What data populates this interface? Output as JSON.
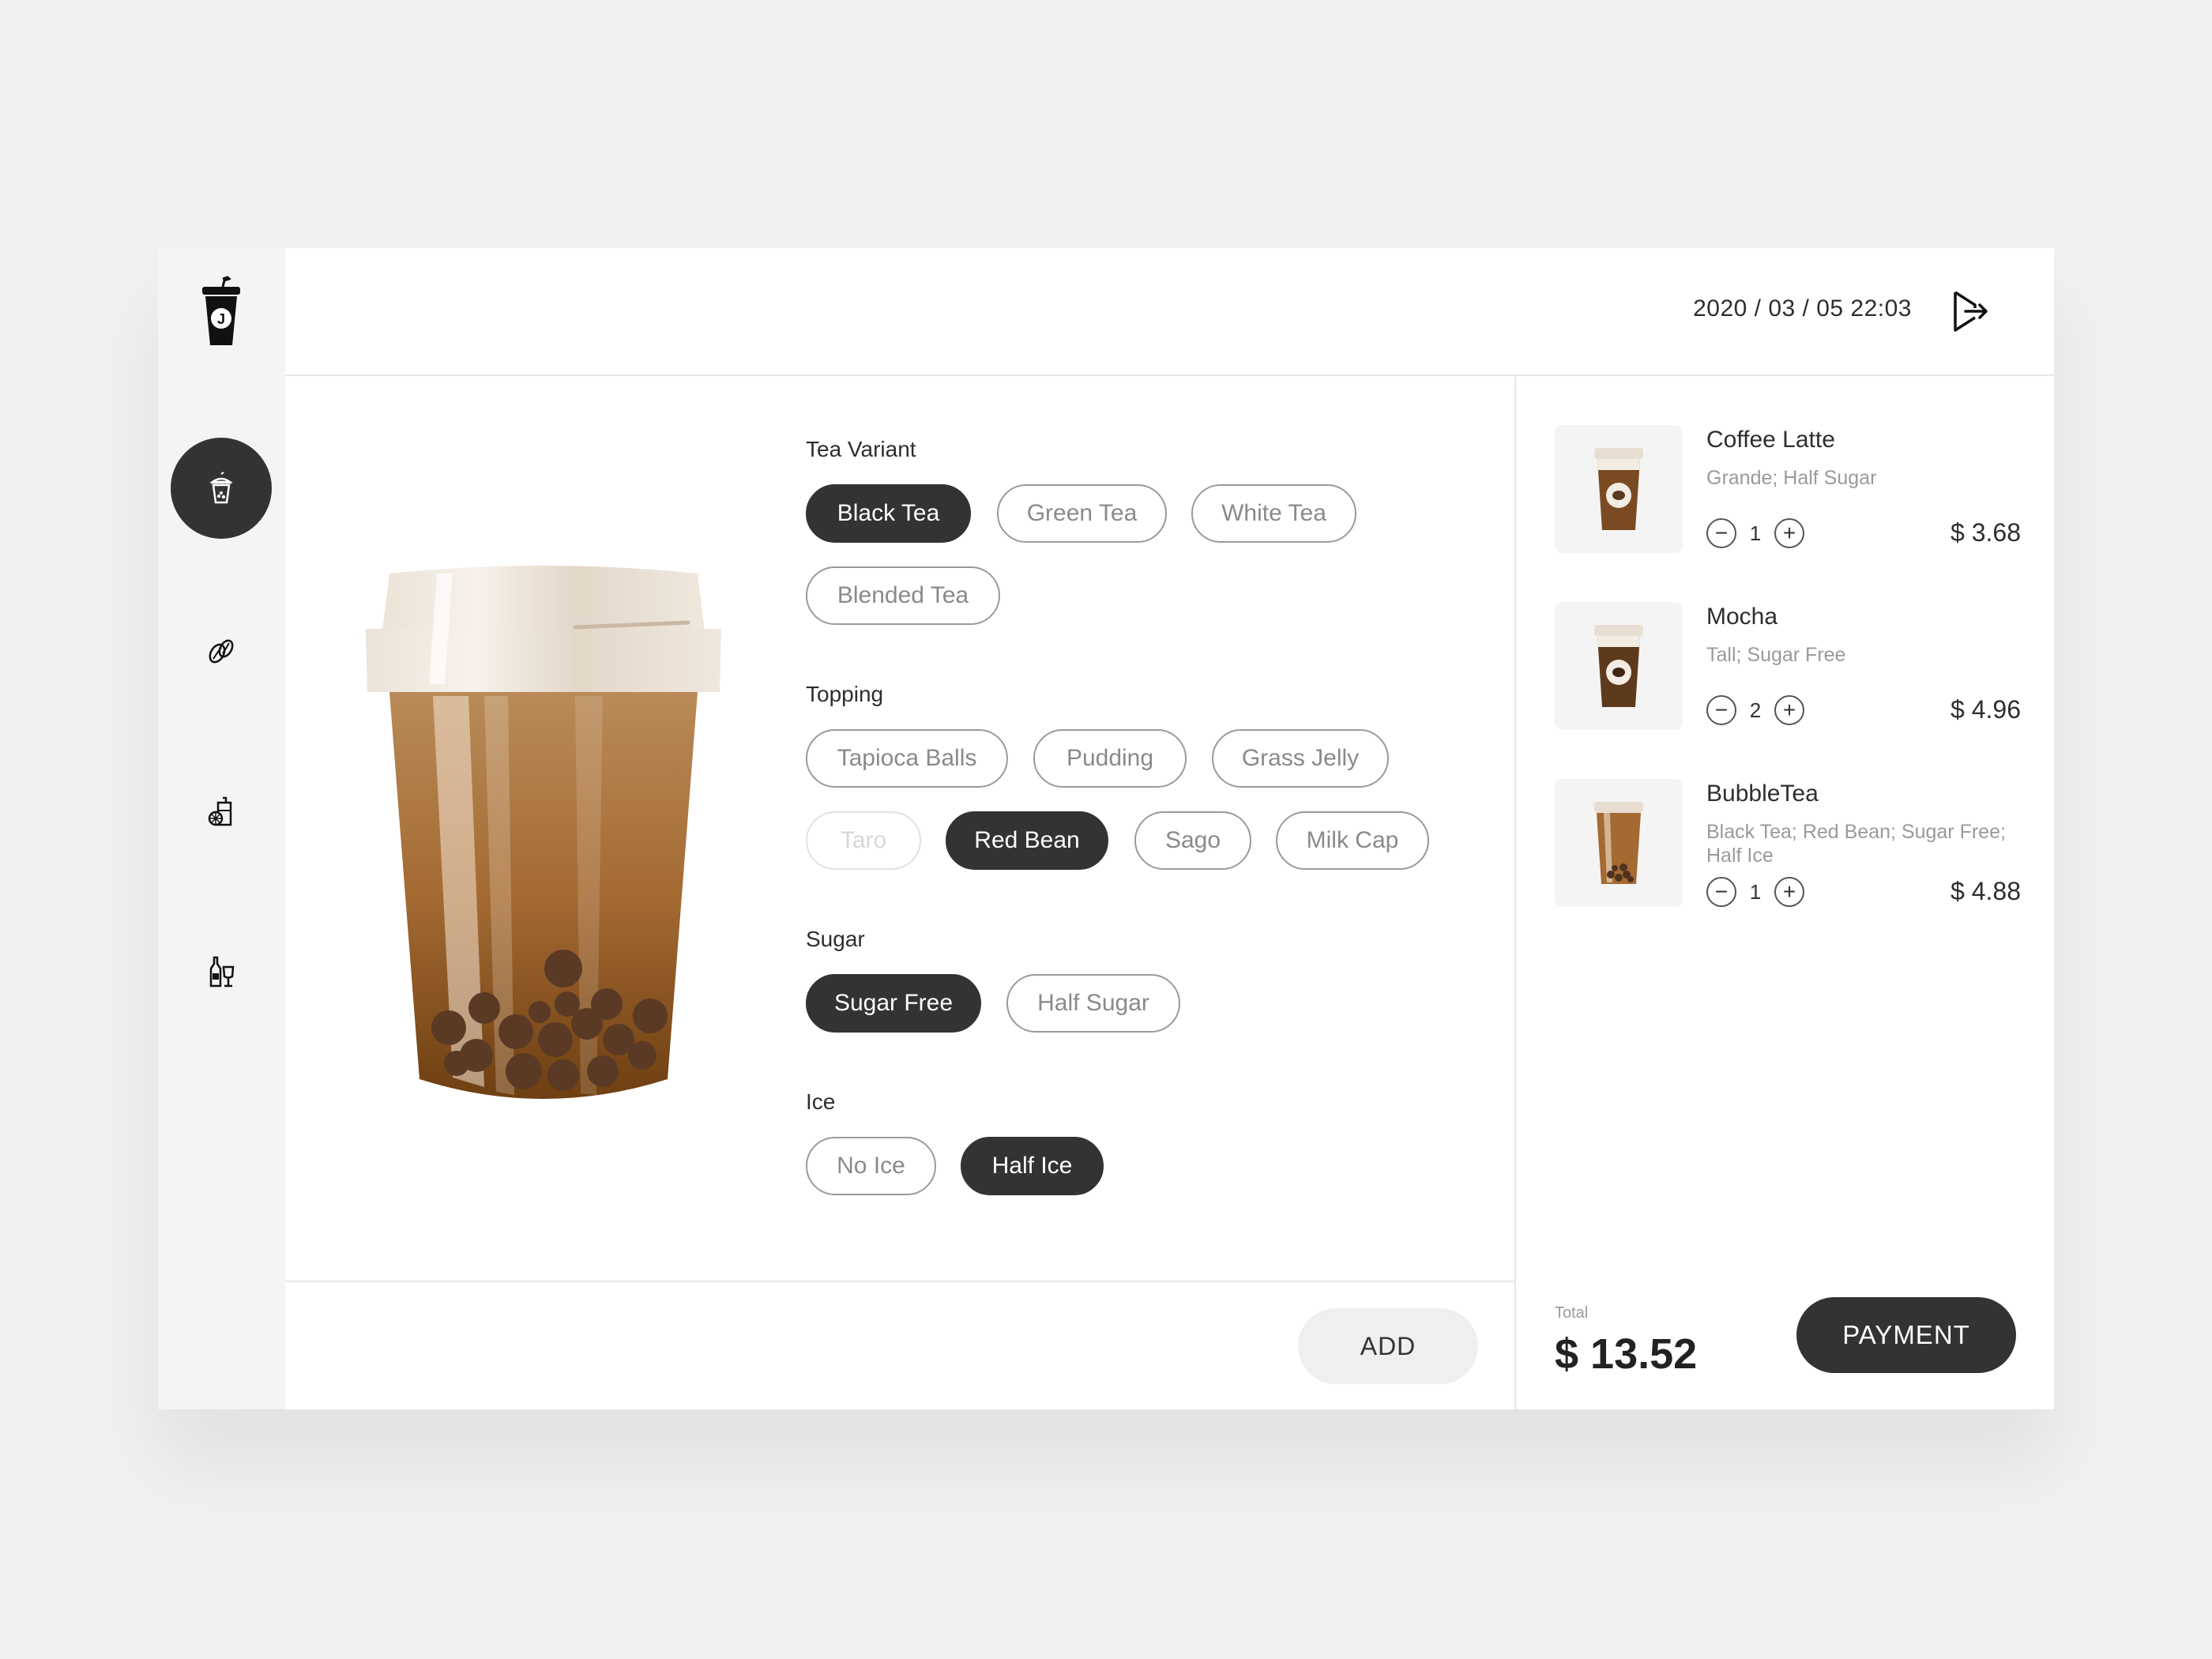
{
  "header": {
    "datetime": "2020 / 03 / 05  22:03"
  },
  "sidebar": {
    "logo_letter": "J",
    "items": [
      {
        "icon": "bubble-tea-icon",
        "active": true
      },
      {
        "icon": "coffee-beans-icon",
        "active": false
      },
      {
        "icon": "juice-icon",
        "active": false
      },
      {
        "icon": "bottles-icon",
        "active": false
      }
    ]
  },
  "product": {
    "options": {
      "tea_variant": {
        "label": "Tea Variant",
        "choices": [
          "Black Tea",
          "Green Tea",
          "White Tea",
          "Blended Tea"
        ],
        "selected": "Black Tea"
      },
      "topping": {
        "label": "Topping",
        "choices": [
          "Tapioca Balls",
          "Pudding",
          "Grass Jelly",
          "Taro",
          "Red Bean",
          "Sago",
          "Milk Cap"
        ],
        "selected": "Red Bean",
        "disabled": [
          "Taro"
        ]
      },
      "sugar": {
        "label": "Sugar",
        "choices": [
          "Sugar Free",
          "Half Sugar"
        ],
        "selected": "Sugar Free"
      },
      "ice": {
        "label": "Ice",
        "choices": [
          "No Ice",
          "Half Ice"
        ],
        "selected": "Half Ice"
      }
    },
    "add_label": "ADD"
  },
  "cart": {
    "items": [
      {
        "name": "Coffee Latte",
        "desc": "Grande; Half Sugar",
        "qty": "1",
        "price": "$ 3.68",
        "thumb": "coffee-cup-icon"
      },
      {
        "name": "Mocha",
        "desc": "Tall; Sugar Free",
        "qty": "2",
        "price": "$ 4.96",
        "thumb": "coffee-cup-icon"
      },
      {
        "name": "BubbleTea",
        "desc": "Black Tea; Red Bean;  Sugar Free; Half Ice",
        "qty": "1",
        "price": "$ 4.88",
        "thumb": "bubble-tea-cup-icon"
      }
    ],
    "total_label": "Total",
    "total_value": "$ 13.52",
    "payment_label": "PAYMENT"
  },
  "colors": {
    "dark": "#333333",
    "background": "#f0f0f0",
    "panel": "#ffffff",
    "muted_text": "#8a8a8a",
    "tea_brown": "#a4652a"
  }
}
